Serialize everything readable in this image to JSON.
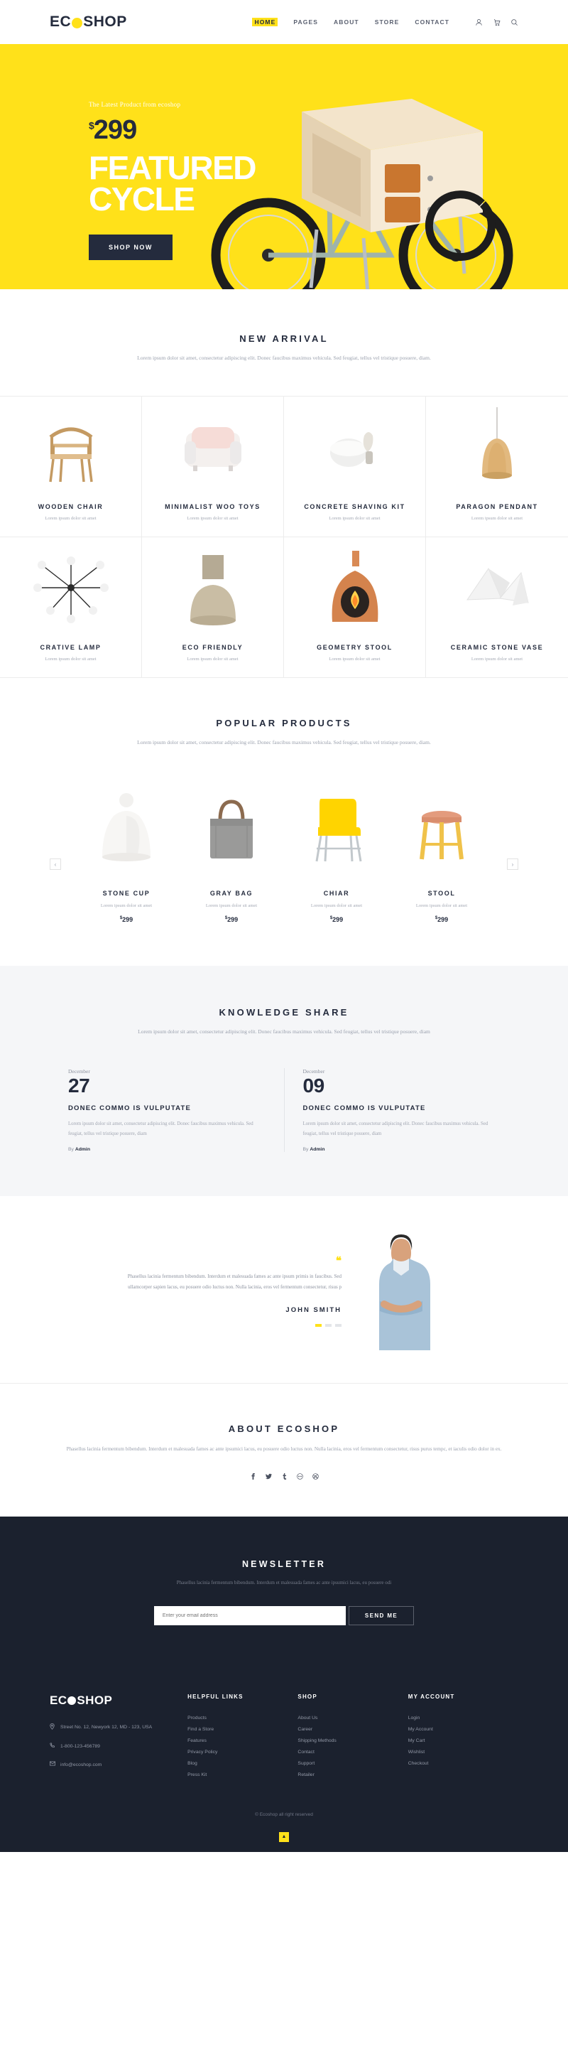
{
  "header": {
    "logo": "ECOSHOP",
    "nav": [
      {
        "label": "HOME",
        "active": true
      },
      {
        "label": "PAGES",
        "active": false
      },
      {
        "label": "ABOUT",
        "active": false
      },
      {
        "label": "STORE",
        "active": false
      },
      {
        "label": "CONTACT",
        "active": false
      }
    ],
    "icons": [
      "user-icon",
      "cart-icon",
      "search-icon"
    ]
  },
  "hero": {
    "subtitle": "The Latest Product from ecoshop",
    "currency": "$",
    "price": "299",
    "title_line1": "FEATURED",
    "title_line2": "CYCLE",
    "cta": "SHOP NOW",
    "bg_color": "#ffe11a",
    "text_color": "#242b3d"
  },
  "new_arrival": {
    "title": "NEW ARRIVAL",
    "desc": "Lorem ipsum dolor sit amet, consectetur adipiscing elit. Donec faucibus maximus vehicula. Sed feugiat, tellus vel tristique posuere, diam.",
    "items": [
      {
        "name": "WOODEN CHAIR",
        "desc": "Lorem ipsum dolor sit amet",
        "art": "chair"
      },
      {
        "name": "MINIMALIST WOO TOYS",
        "desc": "Lorem ipsum dolor sit amet",
        "art": "armchair"
      },
      {
        "name": "CONCRETE SHAVING KIT",
        "desc": "Lorem ipsum dolor sit amet",
        "art": "bowl"
      },
      {
        "name": "PARAGON PENDANT",
        "desc": "Lorem ipsum dolor sit amet",
        "art": "pendant"
      },
      {
        "name": "CRATIVE LAMP",
        "desc": "Lorem ipsum dolor sit amet",
        "art": "lamp"
      },
      {
        "name": "ECO FRIENDLY",
        "desc": "Lorem ipsum dolor sit amet",
        "art": "pot"
      },
      {
        "name": "GEOMETRY STOOL",
        "desc": "Lorem ipsum dolor sit amet",
        "art": "fireplace"
      },
      {
        "name": "CERAMIC STONE VASE",
        "desc": "Lorem ipsum dolor sit amet",
        "art": "vase"
      }
    ]
  },
  "popular": {
    "title": "POPULAR PRODUCTS",
    "desc": "Lorem ipsum dolor sit amet, consectetur adipiscing elit. Donec faucibus maximus vehicula. Sed feugiat, tellus vel tristique posuere, diam.",
    "prev": "‹",
    "next": "›",
    "items": [
      {
        "name": "STONE CUP",
        "desc": "Lorem ipsum dolor sit amet",
        "currency": "$",
        "price": "299",
        "art": "stonecup"
      },
      {
        "name": "GRAY BAG",
        "desc": "Lorem ipsum dolor sit amet",
        "currency": "$",
        "price": "299",
        "art": "bag"
      },
      {
        "name": "CHIAR",
        "desc": "Lorem ipsum dolor sit amet",
        "currency": "$",
        "price": "299",
        "art": "yellowchair"
      },
      {
        "name": "STOOL",
        "desc": "Lorem ipsum dolor sit amet",
        "currency": "$",
        "price": "299",
        "art": "stool"
      }
    ]
  },
  "knowledge": {
    "title": "KNOWLEDGE SHARE",
    "desc": "Lorem ipsum dolor sit amet, consectetur adipiscing elit. Donec faucibus maximus vehicula. Sed feugiat, tellus vel tristique posuere, diam",
    "posts": [
      {
        "month": "December",
        "day": "27",
        "title": "DONEC COMMO IS VULPUTATE",
        "text": "Lorem ipsum dolor sit amet, consectetur adipiscing elit. Donec faucibus maximus vehicula. Sed feugiat, tellus vel tristique posuere, diam",
        "by_prefix": "By ",
        "author": "Admin"
      },
      {
        "month": "December",
        "day": "09",
        "title": "DONEC COMMO IS VULPUTATE",
        "text": "Lorem ipsum dolor sit amet, consectetur adipiscing elit. Donec faucibus maximus vehicula. Sed feugiat, tellus vel tristique posuere, diam",
        "by_prefix": "By ",
        "author": "Admin"
      }
    ]
  },
  "testimonial": {
    "quote_icon": "❝",
    "quote": "Phasellus lacinia fermentum bibendum. Interdum et malesuada fames ac ante ipsum primis in faucibus. Sed ullamcorper sapien lacus, eu posuere odio luctus non. Nulla lacinia, eros vel fermentum consectetur, risus p",
    "name": "JOHN SMITH",
    "dots": 3,
    "active_dot": 0
  },
  "about": {
    "title": "ABOUT ECOSHOP",
    "desc": "Phasellus lacinia fermentum bibendum. Interdum et malesuada fames ac ante ipsumici lacus, eu posuere odio luctus non. Nulla lacinia, eros vel fermentum consectetur, risus purus tempc, et iaculis odio dolor in ex.",
    "socials": [
      "facebook-icon",
      "twitter-icon",
      "tumblr-icon",
      "flickr-icon",
      "dribbble-icon"
    ]
  },
  "newsletter": {
    "title": "NEWSLETTER",
    "desc": "Phasellus lacinia fermentum bibendum. Interdum et malesuada fames ac ante ipsumici lacus, eu posuere odi",
    "placeholder": "Enter your email address",
    "button": "SEND ME",
    "bg_color": "#1b212e"
  },
  "footer": {
    "logo": "ECOSHOP",
    "address": "Street No. 12, Newyork 12, MD - 123, USA",
    "phone": "1-800-123-456789",
    "email": "info@ecoshop.com",
    "columns": [
      {
        "heading": "HELPFUL LINKS",
        "links": [
          "Products",
          "Find a Store",
          "Features",
          "Privacy Policy",
          "Blog",
          "Press Kit"
        ]
      },
      {
        "heading": "SHOP",
        "links": [
          "About Us",
          "Career",
          "Shipping Methods",
          "Contact",
          "Support",
          "Retailer"
        ]
      },
      {
        "heading": "MY ACCOUNT",
        "links": [
          "Login",
          "My Account",
          "My Cart",
          "Wishlist",
          "Checkout"
        ]
      }
    ],
    "copyright": "© Ecoshop all right reserved",
    "to_top": "▲"
  }
}
